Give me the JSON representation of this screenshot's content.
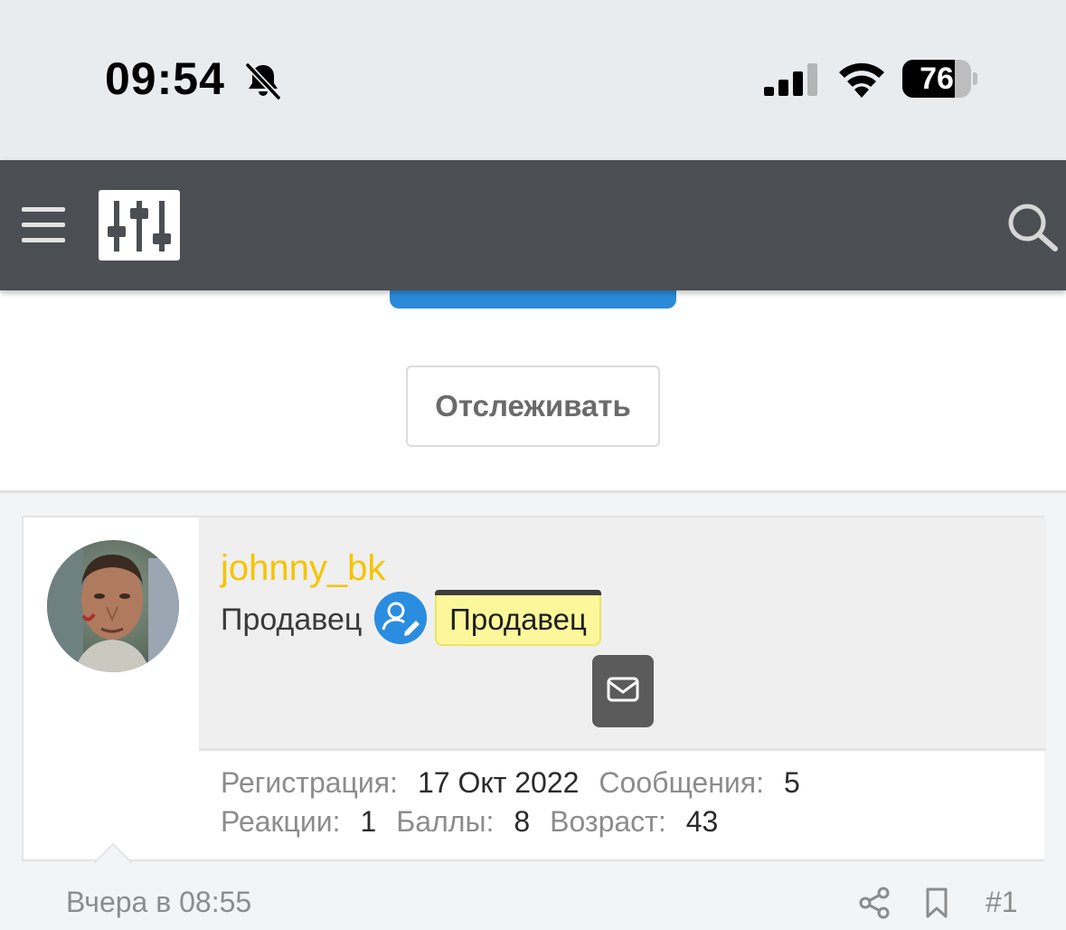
{
  "status_bar": {
    "time": "09:54",
    "battery_level": "76",
    "battery_fraction": 0.76,
    "icons": [
      "bell-slash-icon",
      "cellular-signal-icon",
      "wifi-icon",
      "battery-icon"
    ]
  },
  "navbar": {
    "icons": [
      "hamburger-menu-icon",
      "sliders-logo-icon",
      "search-icon"
    ],
    "background": "#4b4e52"
  },
  "follow_button": {
    "label": "Отслеживать"
  },
  "post": {
    "username": "johnny_bk",
    "username_color": "#f5c400",
    "user_title": "Продавец",
    "banner": "Продавец",
    "banner_color": "#fdf79b",
    "seller_icon": "user-edit-icon",
    "message_icon": "envelope-icon",
    "stats": {
      "registration_label": "Регистрация:",
      "registration_value": "17 Окт 2022",
      "messages_label": "Сообщения:",
      "messages_value": "5",
      "reactions_label": "Реакции:",
      "reactions_value": "1",
      "points_label": "Баллы:",
      "points_value": "8",
      "age_label": "Возраст:",
      "age_value": "43"
    },
    "footer": {
      "date": "Вчера в 08:55",
      "number": "#1",
      "icons": [
        "share-icon",
        "bookmark-icon"
      ]
    }
  }
}
